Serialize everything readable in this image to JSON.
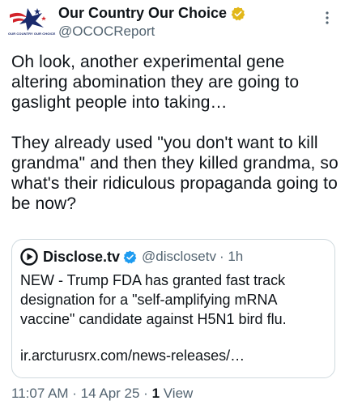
{
  "author": {
    "name": "Our Country Our Choice",
    "handle": "@OCOCReport",
    "avatar_text": "OUR COUNTRY OUR CHOICE"
  },
  "tweet": {
    "text": "Oh look, another experimental gene altering abomination they are going to gaslight people into taking…\n\nThey already used \"you don't want to kill grandma\" and then they killed grandma, so what's their ridiculous propaganda going to be now?"
  },
  "quote": {
    "name": "Disclose.tv",
    "handle": "@disclosetv",
    "time": "· 1h",
    "text": "NEW - Trump FDA has granted fast track designation for a \"self-amplifying mRNA vaccine\" candidate against H5N1 bird flu.",
    "link": "ir.arcturusrx.com/news-releases/…"
  },
  "meta": {
    "timestamp": "11:07 AM · 14 Apr 25 · ",
    "view_count": "1",
    "view_label": " View"
  },
  "icons": {
    "avatar": "eagle-flag-logo-icon",
    "verified_gold": "verified-badge-icon",
    "verified_blue": "verified-badge-icon",
    "more": "more-vertical-icon",
    "disclose_logo": "play-circle-icon"
  },
  "colors": {
    "gold_badge": "#e2b719",
    "blue_badge": "#1d9bf0",
    "secondary_text": "#536471"
  }
}
